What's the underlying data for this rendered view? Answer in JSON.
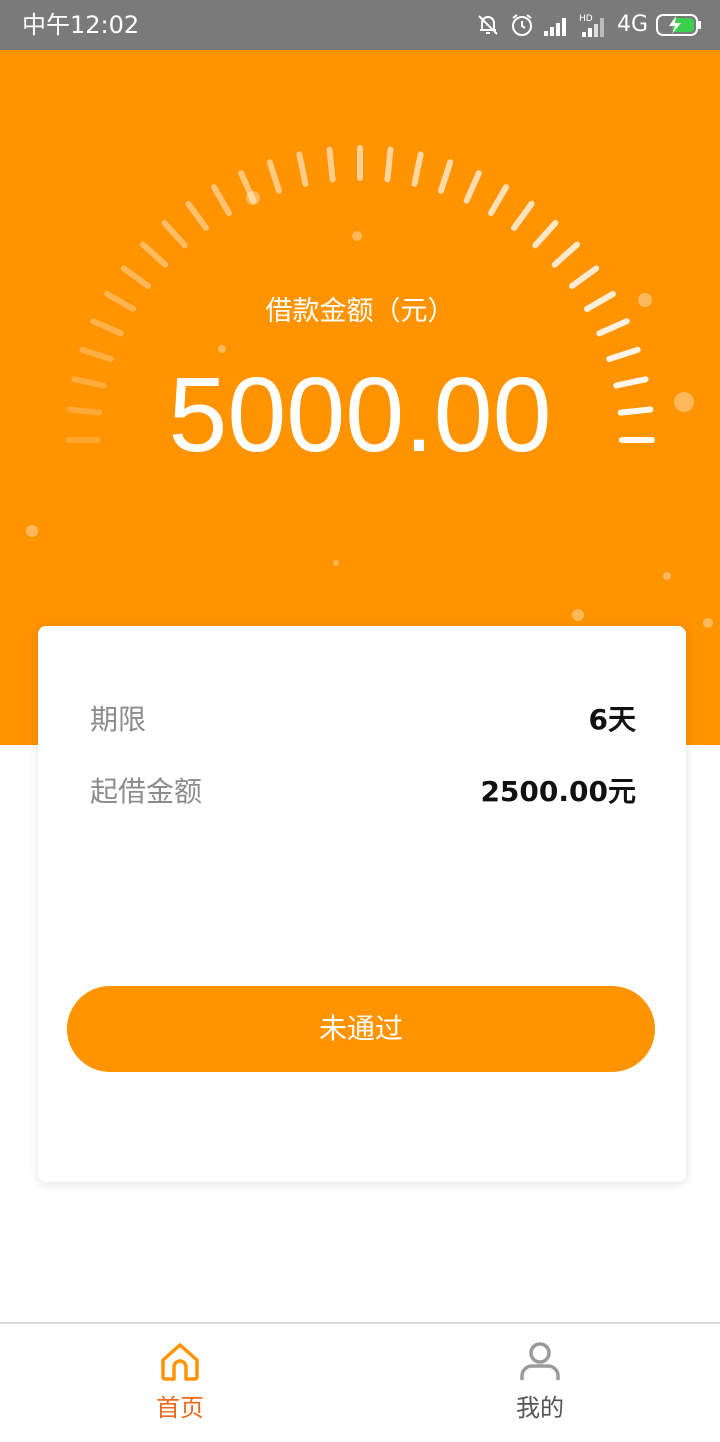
{
  "status_bar": {
    "time": "中午12:02",
    "network": "4G",
    "icons": [
      "mute-bell-icon",
      "alarm-icon",
      "signal-icon",
      "hd-signal-icon",
      "battery-charging-icon"
    ]
  },
  "hero": {
    "label": "借款金额（元）",
    "amount": "5000.00",
    "background": "#ff9300"
  },
  "card": {
    "term_label": "期限",
    "term_value": "6天",
    "min_label": "起借金额",
    "min_value": "2500.00元",
    "button_label": "未通过"
  },
  "tabbar": {
    "home_label": "首页",
    "home_icon": "home-icon",
    "mine_label": "我的",
    "mine_icon": "user-icon",
    "active_color": "#f06a1d"
  }
}
